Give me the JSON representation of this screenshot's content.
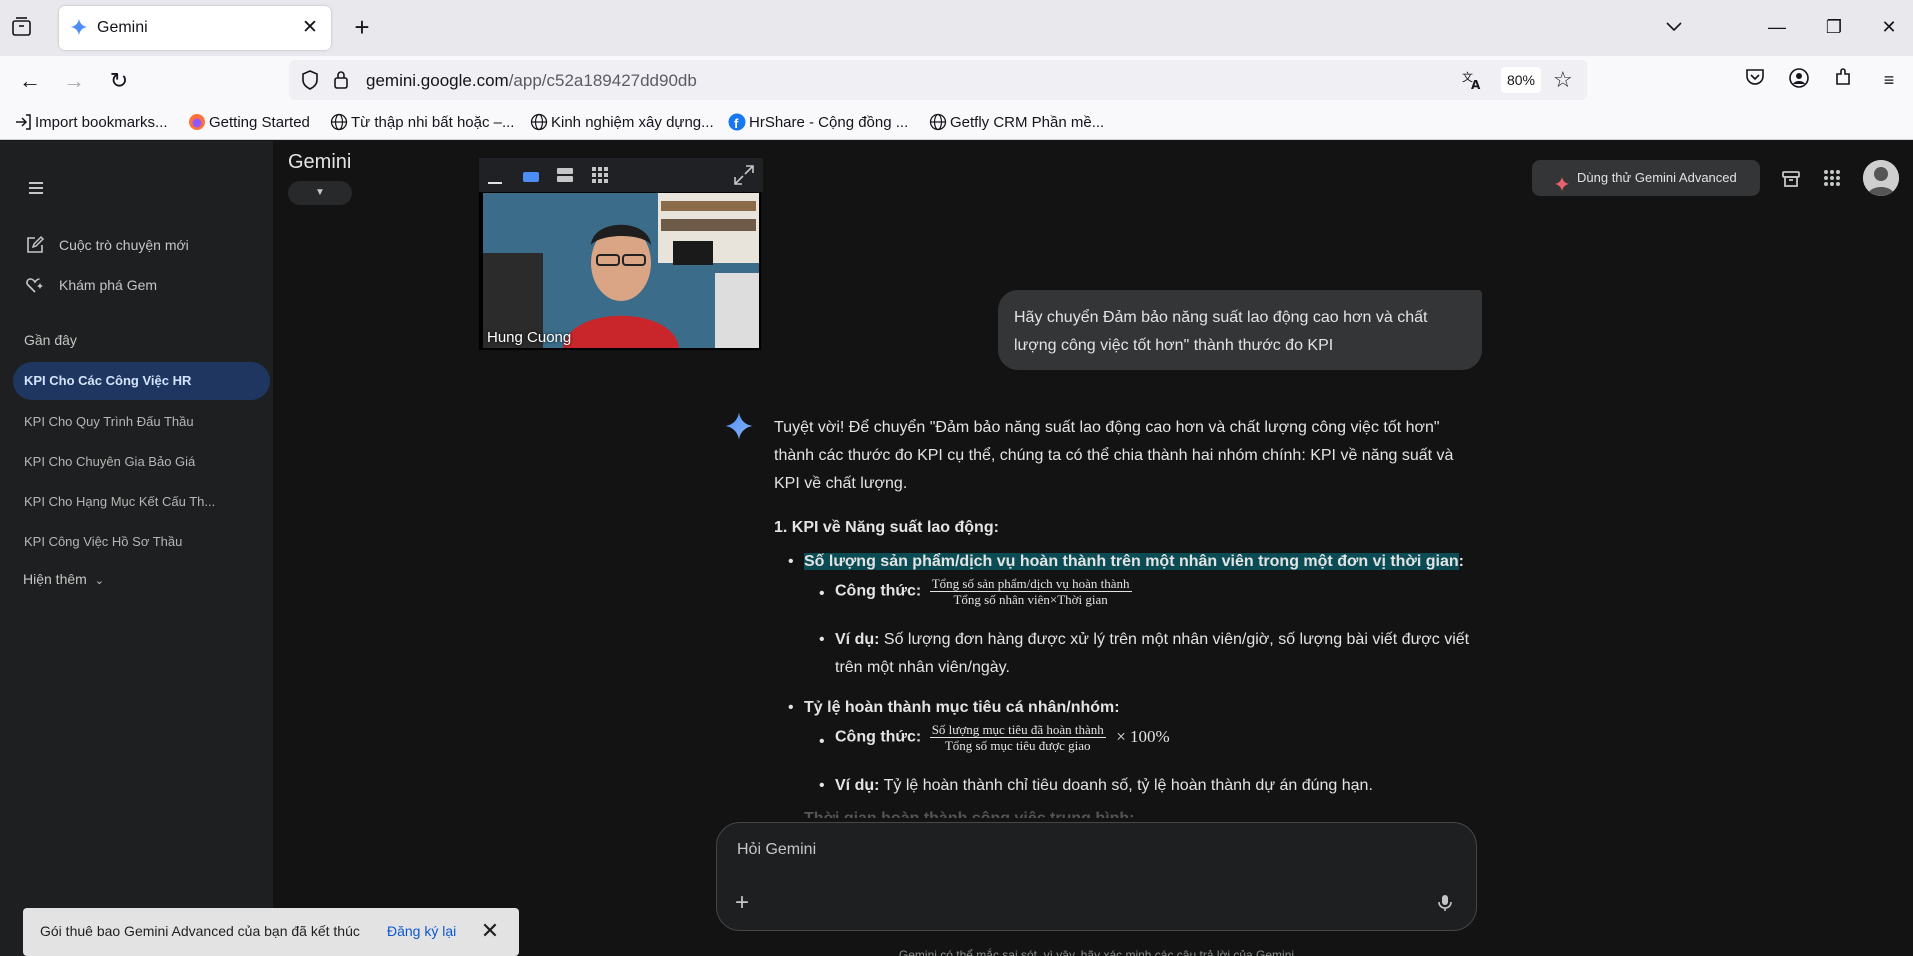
{
  "browser": {
    "tab_title": "Gemini",
    "url_domain": "gemini.google.com",
    "url_path": "/app/c52a189427dd90db",
    "zoom": "80%",
    "bookmarks": [
      {
        "label": "Import bookmarks...",
        "icon": "import-icon"
      },
      {
        "label": "Getting Started",
        "icon": "firefox-icon"
      },
      {
        "label": "Từ thập nhi bất hoặc –...",
        "icon": "globe-icon"
      },
      {
        "label": "Kinh nghiệm xây dựng...",
        "icon": "globe-icon"
      },
      {
        "label": "HrShare - Cộng đồng ...",
        "icon": "facebook-icon"
      },
      {
        "label": "Getfly CRM Phần mề...",
        "icon": "globe-icon"
      }
    ]
  },
  "app": {
    "title": "Gemini",
    "advanced_button": "Dùng thử Gemini Advanced",
    "accent": "#4c8df6"
  },
  "sidebar": {
    "new_chat": "Cuộc trò chuyện mới",
    "explore_gem": "Khám phá Gem",
    "recent_label": "Gần đây",
    "items": [
      "KPI Cho Các Công Việc HR",
      "KPI Cho Quy Trình Đấu Thầu",
      "KPI Cho Chuyên Gia Bảo Giá",
      "KPI Cho Hạng Mục Kết Cấu Th...",
      "KPI Công Việc Hồ Sơ Thầu"
    ],
    "show_more": "Hiện thêm"
  },
  "video": {
    "participant_name": "Hung Cuong"
  },
  "conversation": {
    "user_message": "Hãy chuyển Đảm bảo năng suất lao động cao hơn và chất lượng công việc tốt hơn\" thành thước đo KPI",
    "answer_intro": "Tuyệt vời! Để chuyển \"Đảm bảo năng suất lao động cao hơn và chất lượng công việc tốt hơn\" thành các thước đo KPI cụ thể, chúng ta có thể chia thành hai nhóm chính: KPI về năng suất và KPI về chất lượng.",
    "section1_heading": "1. KPI về Năng suất lao động:",
    "kpi1_title": "Số lượng sản phẩm/dịch vụ hoàn thành trên một nhân viên trong một đơn vị thời gian",
    "kpi1_formula_label": "Công thức:",
    "kpi1_formula_num": "Tổng số sản phẩm/dịch vụ hoàn thành",
    "kpi1_formula_den": "Tổng số nhân viên×Thời gian",
    "kpi1_example_label": "Ví dụ:",
    "kpi1_example": "Số lượng đơn hàng được xử lý trên một nhân viên/giờ, số lượng bài viết được viết trên một nhân viên/ngày.",
    "kpi2_title": "Tỷ lệ hoàn thành mục tiêu cá nhân/nhóm:",
    "kpi2_formula_label": "Công thức:",
    "kpi2_formula_num": "Số lượng mục tiêu đã hoàn thành",
    "kpi2_formula_den": "Tổng số mục tiêu được giao",
    "kpi2_formula_suffix": "× 100%",
    "kpi2_example_label": "Ví dụ:",
    "kpi2_example": "Tỷ lệ hoàn thành chỉ tiêu doanh số, tỷ lệ hoàn thành dự án đúng hạn.",
    "faded_next": "Thời gian hoàn thành công việc trung bình:"
  },
  "input": {
    "placeholder": "Hỏi Gemini",
    "disclaimer": "Gemini có thể mắc sai sót, vì vậy, hãy xác minh các câu trả lời của Gemini"
  },
  "snackbar": {
    "message": "Gói thuê bao Gemini Advanced của bạn đã kết thúc",
    "action": "Đăng ký lại"
  }
}
